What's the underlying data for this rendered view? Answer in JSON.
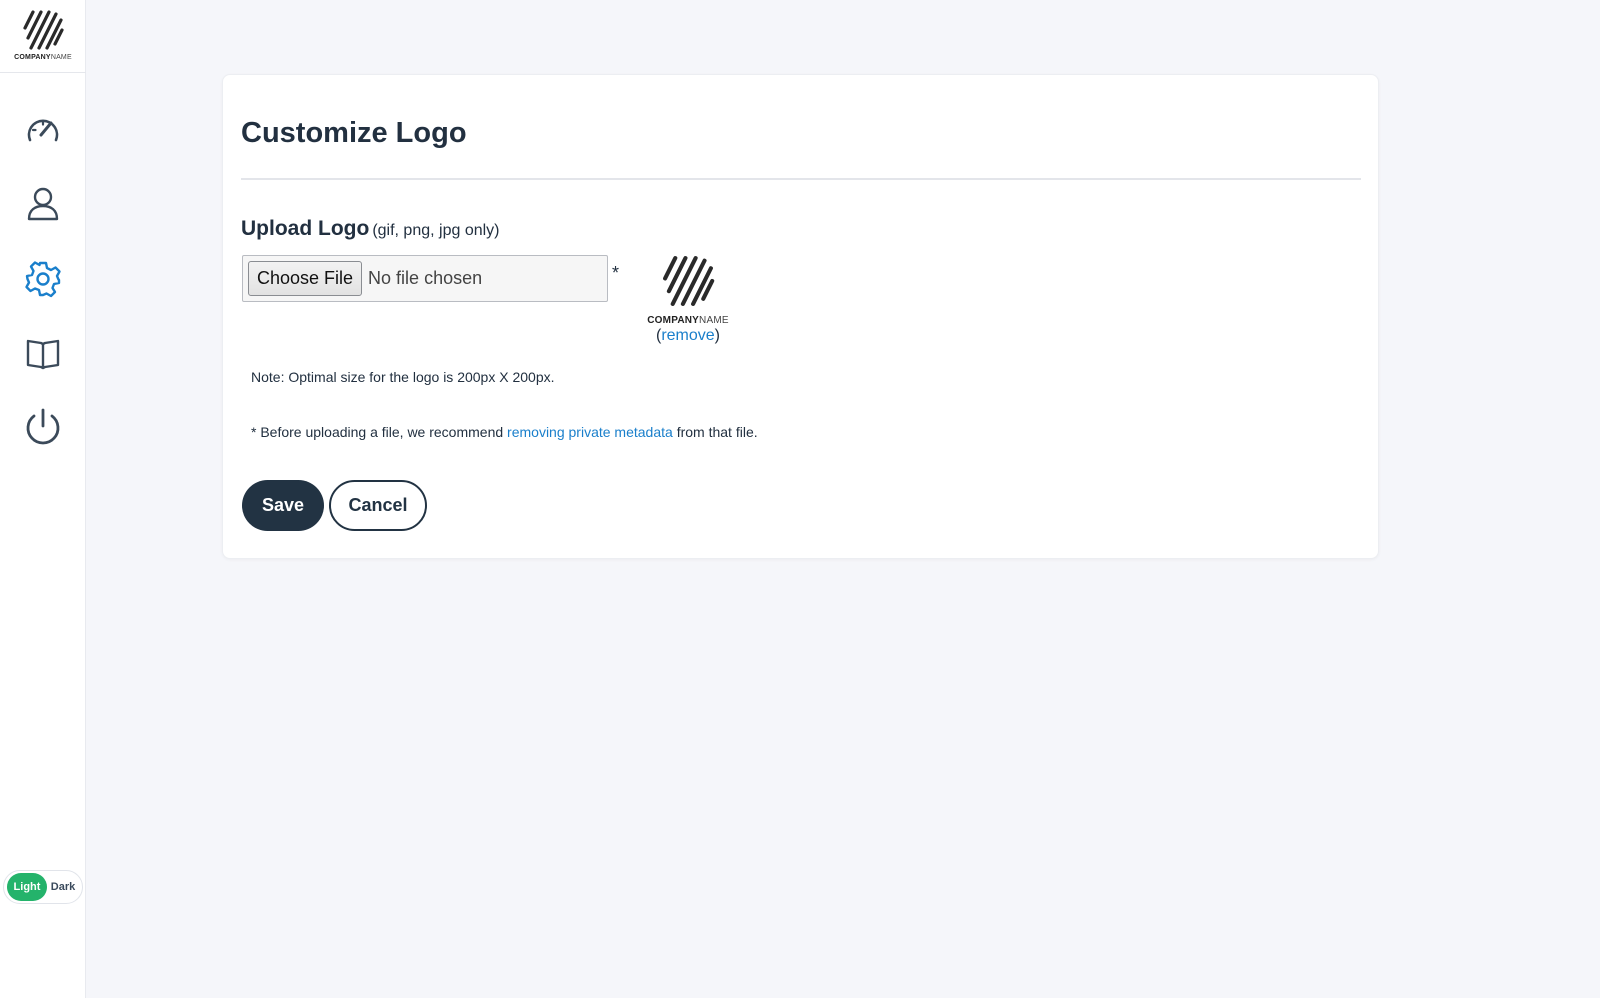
{
  "sidebar": {
    "brand": {
      "company_bold": "COMPANY",
      "company_light": "NAME"
    },
    "nav": [
      {
        "name": "dashboard",
        "icon": "speedometer-icon"
      },
      {
        "name": "profile",
        "icon": "user-icon"
      },
      {
        "name": "settings",
        "icon": "gear-icon",
        "active": true
      },
      {
        "name": "docs",
        "icon": "book-icon"
      },
      {
        "name": "logout",
        "icon": "power-icon"
      }
    ],
    "theme_toggle": {
      "light": "Light",
      "dark": "Dark",
      "selected": "Light"
    }
  },
  "card": {
    "title": "Customize Logo",
    "upload_label": "Upload Logo",
    "upload_hint": "(gif, png, jpg only)",
    "file_button": "Choose File",
    "file_status": "No file chosen",
    "required_marker": "*",
    "preview": {
      "company_bold": "COMPANY",
      "company_light": "NAME"
    },
    "remove_open": "(",
    "remove_link": "remove",
    "remove_close": ")",
    "note": "Note: Optimal size for the logo is 200px X 200px.",
    "metadata_prefix": "* Before uploading a file, we recommend ",
    "metadata_link": "removing private metadata",
    "metadata_suffix": " from that file.",
    "save_label": "Save",
    "cancel_label": "Cancel"
  },
  "colors": {
    "accent_blue": "#1a7fcb",
    "active_icon": "#1a7fcb",
    "toggle_green": "#24b36b",
    "dark_navy": "#223343",
    "background": "#f5f6fa"
  }
}
